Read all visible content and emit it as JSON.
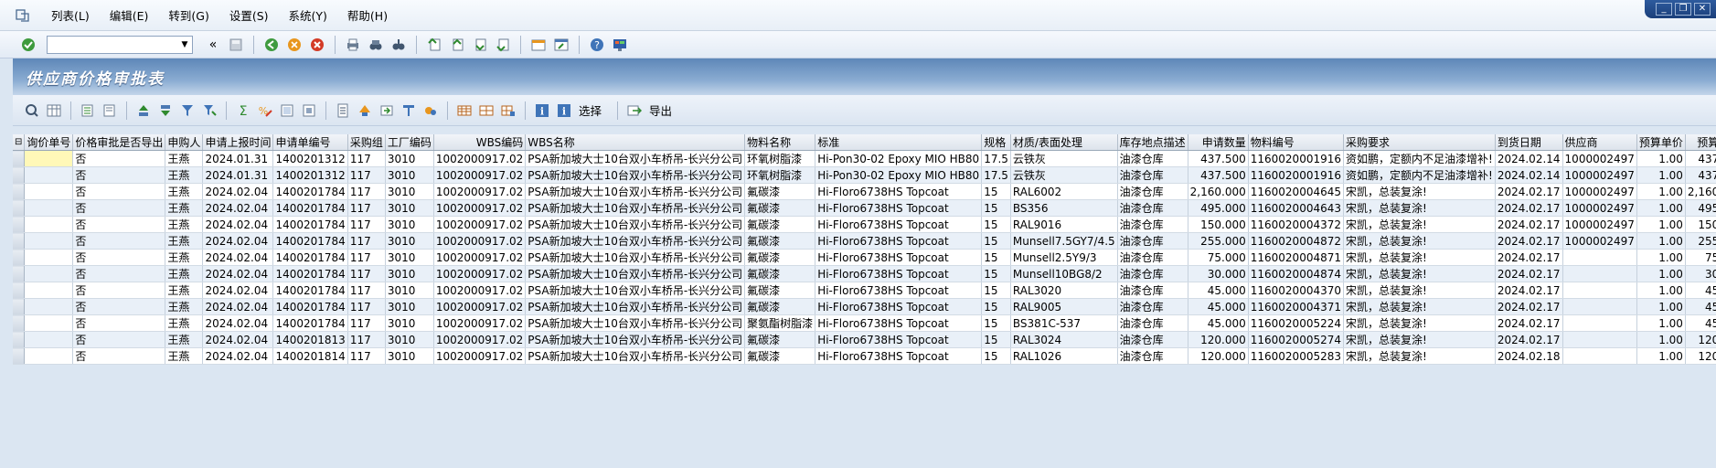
{
  "menu": [
    "列表(L)",
    "编辑(E)",
    "转到(G)",
    "设置(S)",
    "系统(Y)",
    "帮助(H)"
  ],
  "toolbar": {
    "command_value": ""
  },
  "title": "供应商价格审批表",
  "toolbar2": {
    "select_label": "选择",
    "export_label": "导出"
  },
  "table": {
    "columns": [
      "询价单号",
      "价格审批是否导出",
      "申购人",
      "申请上报时间",
      "申请单编号",
      "采购组",
      "工厂编码",
      "WBS编码",
      "WBS名称",
      "物料名称",
      "标准",
      "规格",
      "材质/表面处理",
      "库存地点描述",
      "申请数量",
      "物料编号",
      "采购要求",
      "到货日期",
      "供应商",
      "预算单价",
      "预算"
    ],
    "rows": [
      [
        "",
        "否",
        "王燕",
        "2024.01.31",
        "1400201312",
        "117",
        "3010",
        "1002000917.02",
        "PSA新加坡大士10台双小车桥吊-长兴分公司",
        "环氧树脂漆",
        "Hi-Pon30-02 Epoxy MIO HB80",
        "17.5",
        "云铁灰",
        "油漆仓库",
        "437.500",
        "1160020001916",
        "资如鹏，定额内不足油漆增补!",
        "2024.02.14",
        "1000002497",
        "1.00",
        "437"
      ],
      [
        "",
        "否",
        "王燕",
        "2024.01.31",
        "1400201312",
        "117",
        "3010",
        "1002000917.02",
        "PSA新加坡大士10台双小车桥吊-长兴分公司",
        "环氧树脂漆",
        "Hi-Pon30-02 Epoxy MIO HB80",
        "17.5",
        "云铁灰",
        "油漆仓库",
        "437.500",
        "1160020001916",
        "资如鹏，定额内不足油漆增补!",
        "2024.02.14",
        "1000002497",
        "1.00",
        "437"
      ],
      [
        "",
        "否",
        "王燕",
        "2024.02.04",
        "1400201784",
        "117",
        "3010",
        "1002000917.02",
        "PSA新加坡大士10台双小车桥吊-长兴分公司",
        "氟碳漆",
        "Hi-Floro6738HS Topcoat",
        "15",
        "RAL6002",
        "油漆仓库",
        "2,160.000",
        "1160020004645",
        "宋凯，总装复涂!",
        "2024.02.17",
        "1000002497",
        "1.00",
        "2,160"
      ],
      [
        "",
        "否",
        "王燕",
        "2024.02.04",
        "1400201784",
        "117",
        "3010",
        "1002000917.02",
        "PSA新加坡大士10台双小车桥吊-长兴分公司",
        "氟碳漆",
        "Hi-Floro6738HS Topcoat",
        "15",
        "BS356",
        "油漆仓库",
        "495.000",
        "1160020004643",
        "宋凯，总装复涂!",
        "2024.02.17",
        "1000002497",
        "1.00",
        "495"
      ],
      [
        "",
        "否",
        "王燕",
        "2024.02.04",
        "1400201784",
        "117",
        "3010",
        "1002000917.02",
        "PSA新加坡大士10台双小车桥吊-长兴分公司",
        "氟碳漆",
        "Hi-Floro6738HS Topcoat",
        "15",
        "RAL9016",
        "油漆仓库",
        "150.000",
        "1160020004372",
        "宋凯，总装复涂!",
        "2024.02.17",
        "1000002497",
        "1.00",
        "150"
      ],
      [
        "",
        "否",
        "王燕",
        "2024.02.04",
        "1400201784",
        "117",
        "3010",
        "1002000917.02",
        "PSA新加坡大士10台双小车桥吊-长兴分公司",
        "氟碳漆",
        "Hi-Floro6738HS Topcoat",
        "15",
        "Munsell7.5GY7/4.5",
        "油漆仓库",
        "255.000",
        "1160020004872",
        "宋凯，总装复涂!",
        "2024.02.17",
        "1000002497",
        "1.00",
        "255"
      ],
      [
        "",
        "否",
        "王燕",
        "2024.02.04",
        "1400201784",
        "117",
        "3010",
        "1002000917.02",
        "PSA新加坡大士10台双小车桥吊-长兴分公司",
        "氟碳漆",
        "Hi-Floro6738HS Topcoat",
        "15",
        "Munsell2.5Y9/3",
        "油漆仓库",
        "75.000",
        "1160020004871",
        "宋凯，总装复涂!",
        "2024.02.17",
        "",
        "1.00",
        "75"
      ],
      [
        "",
        "否",
        "王燕",
        "2024.02.04",
        "1400201784",
        "117",
        "3010",
        "1002000917.02",
        "PSA新加坡大士10台双小车桥吊-长兴分公司",
        "氟碳漆",
        "Hi-Floro6738HS Topcoat",
        "15",
        "Munsell10BG8/2",
        "油漆仓库",
        "30.000",
        "1160020004874",
        "宋凯，总装复涂!",
        "2024.02.17",
        "",
        "1.00",
        "30"
      ],
      [
        "",
        "否",
        "王燕",
        "2024.02.04",
        "1400201784",
        "117",
        "3010",
        "1002000917.02",
        "PSA新加坡大士10台双小车桥吊-长兴分公司",
        "氟碳漆",
        "Hi-Floro6738HS Topcoat",
        "15",
        "RAL3020",
        "油漆仓库",
        "45.000",
        "1160020004370",
        "宋凯，总装复涂!",
        "2024.02.17",
        "",
        "1.00",
        "45"
      ],
      [
        "",
        "否",
        "王燕",
        "2024.02.04",
        "1400201784",
        "117",
        "3010",
        "1002000917.02",
        "PSA新加坡大士10台双小车桥吊-长兴分公司",
        "氟碳漆",
        "Hi-Floro6738HS Topcoat",
        "15",
        "RAL9005",
        "油漆仓库",
        "45.000",
        "1160020004371",
        "宋凯，总装复涂!",
        "2024.02.17",
        "",
        "1.00",
        "45"
      ],
      [
        "",
        "否",
        "王燕",
        "2024.02.04",
        "1400201784",
        "117",
        "3010",
        "1002000917.02",
        "PSA新加坡大士10台双小车桥吊-长兴分公司",
        "聚氨酯树脂漆",
        "Hi-Floro6738HS Topcoat",
        "15",
        "BS381C-537",
        "油漆仓库",
        "45.000",
        "1160020005224",
        "宋凯，总装复涂!",
        "2024.02.17",
        "",
        "1.00",
        "45"
      ],
      [
        "",
        "否",
        "王燕",
        "2024.02.04",
        "1400201813",
        "117",
        "3010",
        "1002000917.02",
        "PSA新加坡大士10台双小车桥吊-长兴分公司",
        "氟碳漆",
        "Hi-Floro6738HS Topcoat",
        "15",
        "RAL3024",
        "油漆仓库",
        "120.000",
        "1160020005274",
        "宋凯，总装复涂!",
        "2024.02.17",
        "",
        "1.00",
        "120"
      ],
      [
        "",
        "否",
        "王燕",
        "2024.02.04",
        "1400201814",
        "117",
        "3010",
        "1002000917.02",
        "PSA新加坡大士10台双小车桥吊-长兴分公司",
        "氟碳漆",
        "Hi-Floro6738HS Topcoat",
        "15",
        "RAL1026",
        "油漆仓库",
        "120.000",
        "1160020005283",
        "宋凯，总装复涂!",
        "2024.02.18",
        "",
        "1.00",
        "120"
      ]
    ]
  }
}
